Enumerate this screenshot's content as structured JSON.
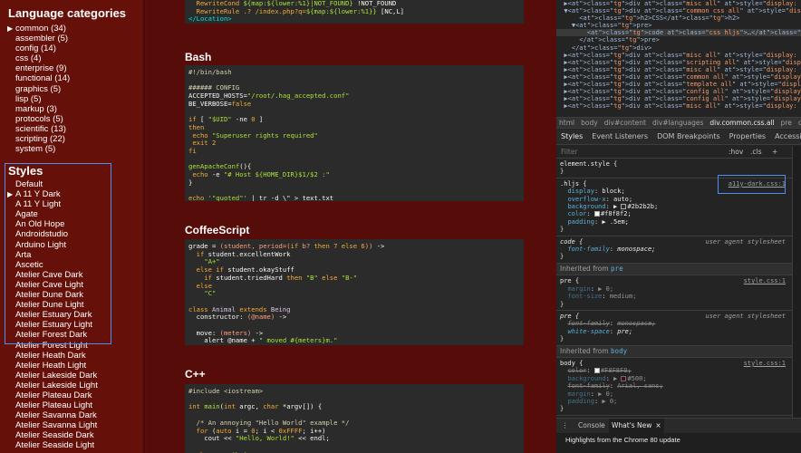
{
  "sidebar": {
    "lang_title": "Language categories",
    "languages": [
      "common (34)",
      "assembler (5)",
      "config (14)",
      "css (4)",
      "enterprise (9)",
      "functional (14)",
      "graphics (5)",
      "lisp (5)",
      "markup (3)",
      "protocols (5)",
      "scientific (13)",
      "scripting (22)",
      "system (5)"
    ],
    "styles_title": "Styles",
    "styles": [
      "Default",
      "A 11 Y Dark",
      "A 11 Y Light",
      "Agate",
      "An Old Hope",
      "Androidstudio",
      "Arduino Light",
      "Arta",
      "Ascetic",
      "Atelier Cave Dark",
      "Atelier Cave Light",
      "Atelier Dune Dark",
      "Atelier Dune Light",
      "Atelier Estuary Dark",
      "Atelier Estuary Light",
      "Atelier Forest Dark",
      "Atelier Forest Light",
      "Atelier Heath Dark",
      "Atelier Heath Light",
      "Atelier Lakeside Dark",
      "Atelier Lakeside Light",
      "Atelier Plateau Dark",
      "Atelier Plateau Light",
      "Atelier Savanna Dark",
      "Atelier Savanna Light",
      "Atelier Seaside Dark",
      "Atelier Seaside Light"
    ],
    "selected_style": "A 11 Y Dark"
  },
  "main": {
    "top_lines": [
      "  RewriteCond ${map:${lower:%1}|NOT_FOUND} !NOT_FOUND",
      "  RewriteRule .? /index.php?q=${map:${lower:%1}} [NC,L]",
      "</Location>"
    ],
    "bash_title": "Bash",
    "coffee_title": "CoffeeScript",
    "cpp_title": "C++"
  },
  "devtools": {
    "elements": [
      "  ▶<div class=\"misc all\" style=\"display: none;\">…</div>",
      "  ▼<div class=\"common css all\" style=\"display: block;\">",
      "      <h2>CSS</h2>",
      "    ▼<pre>",
      "        <code class=\"css hljs\">…</code> == $0",
      "      </pre>",
      "    </div>",
      "  ▶<div class=\"misc all\" style=\"display: none;\">…</div>",
      "  ▶<div class=\"scripting all\" style=\"display: none;\">…</div>",
      "  ▶<div class=\"misc all\" style=\"display: none;\">…</div>",
      "  ▶<div class=\"common all\" style=\"display: block;\">…</div>",
      "  ▶<div class=\"template all\" style=\"display: none;\">…</div>",
      "  ▶<div class=\"config all\" style=\"display: none;\">…</div>",
      "  ▶<div class=\"config all\" style=\"display: none;\">…</div>",
      "  ▶<div class=\"misc all\" style=\"display: none;\">…</div>"
    ],
    "selected_element_index": 4,
    "crumbs": [
      "html",
      "body",
      "div#content",
      "div#languages",
      "div.common.css.all",
      "pre",
      "code.cs"
    ],
    "tabs": [
      "Styles",
      "Event Listeners",
      "DOM Breakpoints",
      "Properties",
      "Accessibility"
    ],
    "active_tab": "Styles",
    "filter_placeholder": "Filter",
    "hov": ":hov",
    "cls": ".cls",
    "plus": "+",
    "element_style": "element.style {",
    "hljs_selector": ".hljs {",
    "hljs_source": "a11y-dark.css:1",
    "hljs_props": [
      {
        "name": "display",
        "value": "block;"
      },
      {
        "name": "overflow-x",
        "value": "auto;"
      },
      {
        "name": "background",
        "value": "▶ #2b2b2b;"
      },
      {
        "name": "color",
        "value": "#f8f8f2;"
      },
      {
        "name": "padding",
        "value": "▶ .5em;"
      }
    ],
    "code_selector": "code {",
    "ua_source": "user agent stylesheet",
    "code_prop": {
      "name": "font-family",
      "value": "monospace;"
    },
    "inherited_pre": "Inherited from",
    "inherited_pre_tag": "pre",
    "pre_source": "style.css:1",
    "pre_props": [
      {
        "name": "margin",
        "value": "▶ 0;"
      },
      {
        "name": "font-size",
        "value": "medium;"
      }
    ],
    "pre_ua_props": [
      {
        "name": "font-family",
        "value": "monospace;"
      },
      {
        "name": "white-space",
        "value": "pre;"
      }
    ],
    "inherited_body_tag": "body",
    "body_source": "style.css:1",
    "body_props": [
      {
        "name": "color",
        "value": "#F8F8F0;"
      },
      {
        "name": "background",
        "value": "▶ #500;"
      },
      {
        "name": "font-family",
        "value": "Arial, sans;"
      },
      {
        "name": "margin",
        "value": "▶ 0;"
      },
      {
        "name": "padding",
        "value": "▶ 0;"
      }
    ],
    "drawer_tab1": "Console",
    "drawer_tab2": "What's New",
    "drawer_close": "×",
    "drawer_body": "Highlights from the Chrome 80 update",
    "colors": {
      "accent": "#4d8ef0",
      "bg": "#242424",
      "page_bg": "#500",
      "code_bg": "#2b2b2b"
    }
  }
}
